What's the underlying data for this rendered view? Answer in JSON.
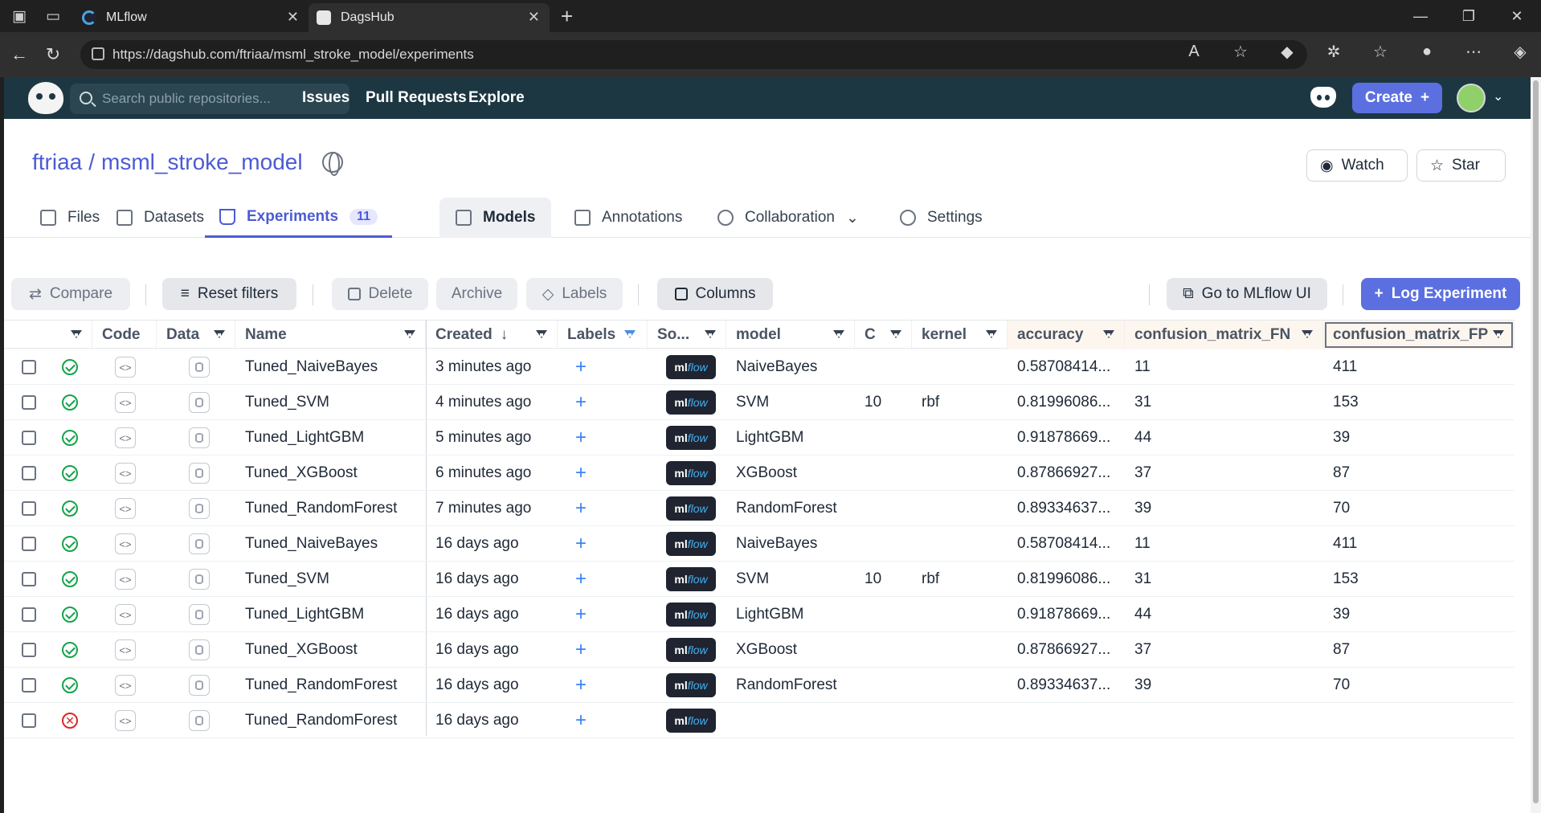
{
  "browser": {
    "tabs": [
      {
        "title": "MLflow"
      },
      {
        "title": "DagsHub"
      }
    ],
    "url": "https://dagshub.com/ftriaa/msml_stroke_model/experiments"
  },
  "topnav": {
    "search_placeholder": "Search public repositories...",
    "links": [
      "Issues",
      "Pull Requests",
      "Explore"
    ],
    "create_label": "Create"
  },
  "repo": {
    "owner": "ftriaa",
    "separator": "/",
    "name": "msml_stroke_model",
    "watch_label": "Watch",
    "star_label": "Star"
  },
  "repo_tabs": {
    "files": "Files",
    "datasets": "Datasets",
    "experiments": "Experiments",
    "experiments_count": "11",
    "models": "Models",
    "annotations": "Annotations",
    "collaboration": "Collaboration",
    "settings": "Settings"
  },
  "toolbar": {
    "compare": "Compare",
    "reset_filters": "Reset filters",
    "delete": "Delete",
    "archive": "Archive",
    "labels": "Labels",
    "columns": "Columns",
    "go_mlflow": "Go to MLflow UI",
    "log_experiment": "Log Experiment"
  },
  "table": {
    "headers": {
      "code": "Code",
      "data": "Data",
      "name": "Name",
      "created": "Created",
      "created_sort": "↓",
      "labels": "Labels",
      "source": "So...",
      "model": "model",
      "c": "C",
      "kernel": "kernel",
      "accuracy": "accuracy",
      "fn": "confusion_matrix_FN",
      "fp": "confusion_matrix_FP"
    },
    "rows": [
      {
        "status": "ok",
        "name": "Tuned_NaiveBayes",
        "created": "3 minutes ago",
        "model": "NaiveBayes",
        "c": "",
        "kernel": "",
        "accuracy": "0.58708414...",
        "fn": "11",
        "fp": "411"
      },
      {
        "status": "ok",
        "name": "Tuned_SVM",
        "created": "4 minutes ago",
        "model": "SVM",
        "c": "10",
        "kernel": "rbf",
        "accuracy": "0.81996086...",
        "fn": "31",
        "fp": "153"
      },
      {
        "status": "ok",
        "name": "Tuned_LightGBM",
        "created": "5 minutes ago",
        "model": "LightGBM",
        "c": "",
        "kernel": "",
        "accuracy": "0.91878669...",
        "fn": "44",
        "fp": "39"
      },
      {
        "status": "ok",
        "name": "Tuned_XGBoost",
        "created": "6 minutes ago",
        "model": "XGBoost",
        "c": "",
        "kernel": "",
        "accuracy": "0.87866927...",
        "fn": "37",
        "fp": "87"
      },
      {
        "status": "ok",
        "name": "Tuned_RandomForest",
        "created": "7 minutes ago",
        "model": "RandomForest",
        "c": "",
        "kernel": "",
        "accuracy": "0.89334637...",
        "fn": "39",
        "fp": "70"
      },
      {
        "status": "ok",
        "name": "Tuned_NaiveBayes",
        "created": "16 days ago",
        "model": "NaiveBayes",
        "c": "",
        "kernel": "",
        "accuracy": "0.58708414...",
        "fn": "11",
        "fp": "411"
      },
      {
        "status": "ok",
        "name": "Tuned_SVM",
        "created": "16 days ago",
        "model": "SVM",
        "c": "10",
        "kernel": "rbf",
        "accuracy": "0.81996086...",
        "fn": "31",
        "fp": "153"
      },
      {
        "status": "ok",
        "name": "Tuned_LightGBM",
        "created": "16 days ago",
        "model": "LightGBM",
        "c": "",
        "kernel": "",
        "accuracy": "0.91878669...",
        "fn": "44",
        "fp": "39"
      },
      {
        "status": "ok",
        "name": "Tuned_XGBoost",
        "created": "16 days ago",
        "model": "XGBoost",
        "c": "",
        "kernel": "",
        "accuracy": "0.87866927...",
        "fn": "37",
        "fp": "87"
      },
      {
        "status": "ok",
        "name": "Tuned_RandomForest",
        "created": "16 days ago",
        "model": "RandomForest",
        "c": "",
        "kernel": "",
        "accuracy": "0.89334637...",
        "fn": "39",
        "fp": "70"
      },
      {
        "status": "failed",
        "name": "Tuned_RandomForest",
        "created": "16 days ago",
        "model": "",
        "c": "",
        "kernel": "",
        "accuracy": "",
        "fn": "",
        "fp": ""
      }
    ],
    "source_badge": {
      "prefix": "ml",
      "suffix": "flow"
    }
  },
  "colors": {
    "brand": "#5b6fe0",
    "nav_bg": "#1d3742",
    "success": "#16a34a",
    "error": "#dc2626"
  }
}
